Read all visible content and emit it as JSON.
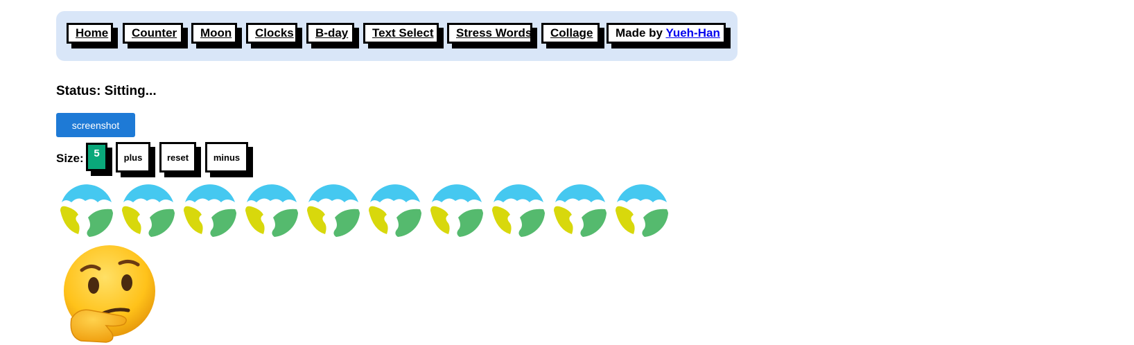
{
  "nav": {
    "items": [
      {
        "label": "Home"
      },
      {
        "label": "Counter"
      },
      {
        "label": "Moon"
      },
      {
        "label": "Clocks"
      },
      {
        "label": "B-day"
      },
      {
        "label": "Text Select"
      },
      {
        "label": "Stress Words"
      },
      {
        "label": "Collage"
      }
    ],
    "credit_prefix": "Made by ",
    "credit_name": "Yueh-Han"
  },
  "status": {
    "text": "Status: Sitting..."
  },
  "screenshot_button": {
    "label": "screenshot"
  },
  "size": {
    "label": "Size:",
    "value": "5",
    "plus_label": "plus",
    "reset_label": "reset",
    "minus_label": "minus"
  },
  "emoji": {
    "earth_count": 10,
    "earth_icon": "globe-showing-americas-icon",
    "thinking_icon": "thinking-face-icon"
  },
  "colors": {
    "nav_bg": "#d9e6f8",
    "button_blue": "#1e7ad6",
    "size_value_bg": "#0aa87a",
    "link_blue": "#0000ee"
  }
}
